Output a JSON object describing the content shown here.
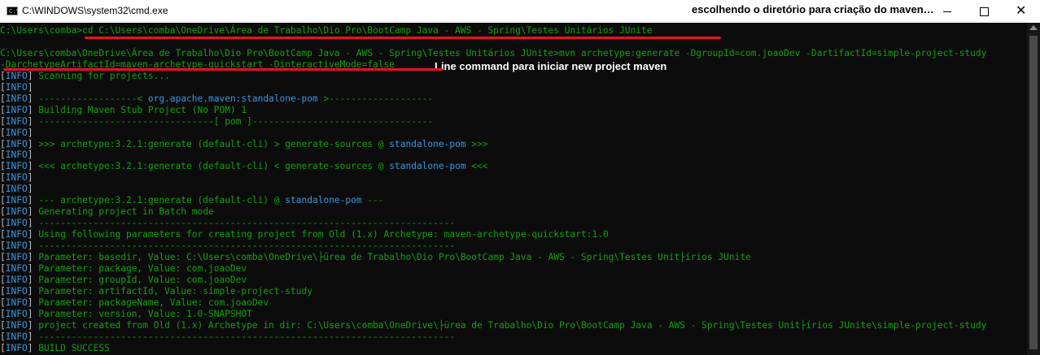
{
  "window": {
    "title": "C:\\WINDOWS\\system32\\cmd.exe",
    "icon_text": "C:\\"
  },
  "annotations": {
    "top": "escolhendo o diretório para criação do maven…",
    "line_command": "Line command para iniciar new project maven"
  },
  "colors": {
    "background": "#0c0c0c",
    "text_green": "#13a10e",
    "info_blue": "#3a96dd",
    "bracket_gray": "#c0c0c0",
    "annotation_red": "#e81123"
  },
  "console": {
    "lines": [
      {
        "text": "C:\\Users\\comba>cd C:\\Users\\comba\\OneDrive\\Área de Trabalho\\Dio Pro\\BootCamp Java - AWS - Spring\\Testes Unitários JUnite"
      },
      {
        "text": ""
      },
      {
        "text": "C:\\Users\\comba\\OneDrive\\Área de Trabalho\\Dio Pro\\BootCamp Java - AWS - Spring\\Testes Unitários JUnite>mvn archetype:generate -DgroupId=com.joaoDev -DartifactId=simple-project-study"
      },
      {
        "text": "-DarchetypeArtifactId=maven-archetype-quickstart -DinteractiveMode=false"
      },
      {
        "info": true,
        "text": " Scanning for projects..."
      },
      {
        "info": true,
        "text": ""
      },
      {
        "info": true,
        "parts": [
          {
            "t": " ------------------< "
          },
          {
            "t": "org.apache.maven:standalone-pom",
            "cyan": true
          },
          {
            "t": " >-------------------"
          }
        ]
      },
      {
        "info": true,
        "text": " Building Maven Stub Project (No POM) 1"
      },
      {
        "info": true,
        "text": " --------------------------------[ pom ]---------------------------------"
      },
      {
        "info": true,
        "text": ""
      },
      {
        "info": true,
        "parts": [
          {
            "t": " >>> archetype:3.2.1:generate (default-cli) > generate-sources @ "
          },
          {
            "t": "standalone-pom",
            "cyan": true
          },
          {
            "t": " >>>"
          }
        ]
      },
      {
        "info": true,
        "text": ""
      },
      {
        "info": true,
        "parts": [
          {
            "t": " <<< archetype:3.2.1:generate (default-cli) < generate-sources @ "
          },
          {
            "t": "standalone-pom",
            "cyan": true
          },
          {
            "t": " <<<"
          }
        ]
      },
      {
        "info": true,
        "text": ""
      },
      {
        "info": true,
        "text": ""
      },
      {
        "info": true,
        "parts": [
          {
            "t": " --- archetype:3.2.1:generate (default-cli) @ "
          },
          {
            "t": "standalone-pom",
            "cyan": true
          },
          {
            "t": " ---"
          }
        ]
      },
      {
        "info": true,
        "text": " Generating project in Batch mode"
      },
      {
        "info": true,
        "text": " ----------------------------------------------------------------------------"
      },
      {
        "info": true,
        "text": " Using following parameters for creating project from Old (1.x) Archetype: maven-archetype-quickstart:1.0"
      },
      {
        "info": true,
        "text": " ----------------------------------------------------------------------------"
      },
      {
        "info": true,
        "text": " Parameter: basedir, Value: C:\\Users\\comba\\OneDrive\\├ürea de Trabalho\\Dio Pro\\BootCamp Java - AWS - Spring\\Testes Unit├írios JUnite"
      },
      {
        "info": true,
        "text": " Parameter: package, Value: com.joaoDev"
      },
      {
        "info": true,
        "text": " Parameter: groupId, Value: com.joaoDev"
      },
      {
        "info": true,
        "text": " Parameter: artifactId, Value: simple-project-study"
      },
      {
        "info": true,
        "text": " Parameter: packageName, Value: com.joaoDev"
      },
      {
        "info": true,
        "text": " Parameter: version, Value: 1.0-SNAPSHOT"
      },
      {
        "info": true,
        "text": " project created from Old (1.x) Archetype in dir: C:\\Users\\comba\\OneDrive\\├ürea de Trabalho\\Dio Pro\\BootCamp Java - AWS - Spring\\Testes Unit├írios JUnite\\simple-project-study"
      },
      {
        "info": true,
        "text": " ----------------------------------------------------------------------------"
      },
      {
        "info": true,
        "text": " BUILD SUCCESS"
      }
    ],
    "info_tag": "INFO"
  }
}
